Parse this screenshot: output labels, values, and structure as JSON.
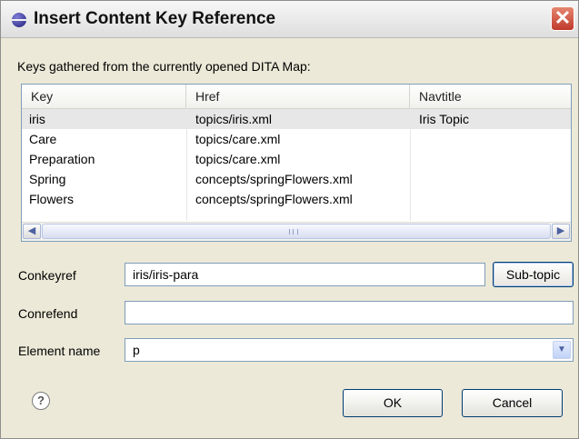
{
  "window": {
    "title": "Insert Content Key Reference",
    "close_glyph": "✕"
  },
  "keys_label": "Keys gathered from the currently opened DITA Map:",
  "table": {
    "columns": [
      "Key",
      "Href",
      "Navtitle"
    ],
    "rows": [
      {
        "key": "iris",
        "href": "topics/iris.xml",
        "navtitle": "Iris Topic",
        "selected": true
      },
      {
        "key": "Care",
        "href": "topics/care.xml",
        "navtitle": ""
      },
      {
        "key": "Preparation",
        "href": "topics/care.xml",
        "navtitle": ""
      },
      {
        "key": "Spring",
        "href": "concepts/springFlowers.xml",
        "navtitle": ""
      },
      {
        "key": "Flowers",
        "href": "concepts/springFlowers.xml",
        "navtitle": ""
      }
    ],
    "scroll_left": "◀",
    "scroll_right": "▶"
  },
  "form": {
    "conkeyref_label": "Conkeyref",
    "conkeyref_value": "iris/iris-para",
    "subtopic_label": "Sub-topic",
    "conrefend_label": "Conrefend",
    "conrefend_value": "",
    "element_name_label": "Element name",
    "element_name_value": "p",
    "dropdown_glyph": "▼"
  },
  "footer": {
    "help_glyph": "?",
    "ok_label": "OK",
    "cancel_label": "Cancel"
  },
  "colors": {
    "background": "#ece9d8",
    "border_accent": "#7f9db9",
    "close_button": "#c0392b",
    "selected_row": "#e7e7e7"
  },
  "icons": [
    "dialog-icon",
    "close-icon",
    "help-icon",
    "scroll-left-icon",
    "scroll-right-icon",
    "chevron-down-icon"
  ]
}
